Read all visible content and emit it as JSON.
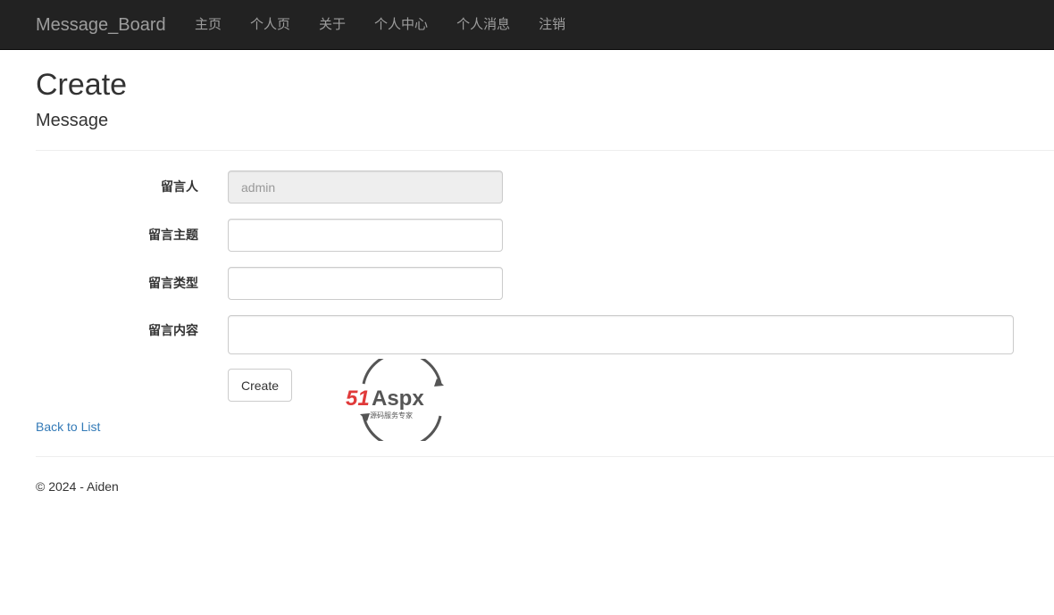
{
  "navbar": {
    "brand": "Message_Board",
    "items": [
      {
        "label": "主页"
      },
      {
        "label": "个人页"
      },
      {
        "label": "关于"
      },
      {
        "label": "个人中心"
      },
      {
        "label": "个人消息"
      },
      {
        "label": "注销"
      }
    ],
    "background_color": "#222222",
    "text_color": "#9d9d9d"
  },
  "page": {
    "title": "Create",
    "subtitle": "Message"
  },
  "form": {
    "author": {
      "label": "留言人",
      "value": "admin"
    },
    "subject": {
      "label": "留言主题",
      "value": ""
    },
    "type": {
      "label": "留言类型",
      "value": ""
    },
    "content": {
      "label": "留言内容",
      "value": ""
    },
    "submit_label": "Create"
  },
  "back_link": "Back to List",
  "footer": {
    "copyright": "© 2024 - Aiden"
  },
  "watermark": {
    "brand": "51Aspx",
    "tagline": "源码服务专家",
    "icon": "51aspx-logo-icon"
  },
  "colors": {
    "link": "#337ab7",
    "watermark_red": "#e03a3a",
    "watermark_green": "#4caf50"
  }
}
